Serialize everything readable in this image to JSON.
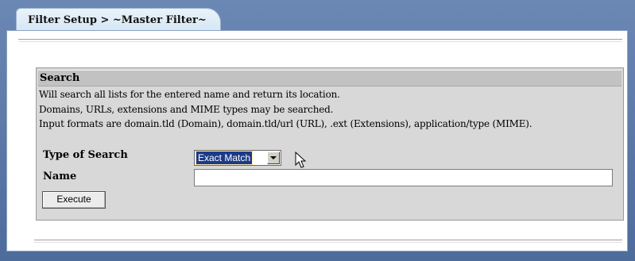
{
  "tab": {
    "label": "Filter Setup > ~Master Filter~"
  },
  "search": {
    "title": "Search",
    "description_lines": [
      "Will search all lists for the entered name and return its location.",
      "Domains, URLs, extensions and MIME types may be searched.",
      "Input formats are domain.tld (Domain), domain.tld/url (URL), .ext (Extensions), application/type (MIME)."
    ],
    "type_label": "Type of Search",
    "type_selected": "Exact Match",
    "name_label": "Name",
    "name_value": "",
    "execute_label": "Execute"
  },
  "icons": {
    "dropdown": "chevron-down-icon",
    "cursor": "mouse-pointer-icon"
  },
  "colors": {
    "frame": "#5a78a8",
    "tab_bg": "#e3eef8",
    "search_bg": "#d8d8d8",
    "header_bg": "#c2c2c2",
    "selection": "#1c3a86"
  }
}
